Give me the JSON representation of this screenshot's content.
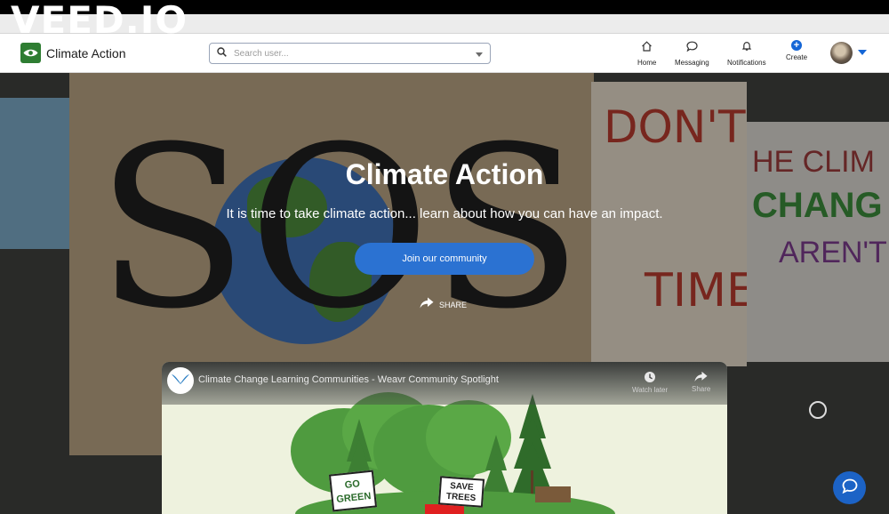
{
  "watermark": "VEED.IO",
  "brand": {
    "title": "Climate Action"
  },
  "search": {
    "placeholder": "Search user..."
  },
  "nav": [
    {
      "label": "Home",
      "icon": "home-icon"
    },
    {
      "label": "Messaging",
      "icon": "chat-bubble-icon"
    },
    {
      "label": "Notifications",
      "icon": "bell-icon"
    },
    {
      "label": "Create",
      "icon": "plus-circle-icon"
    }
  ],
  "hero": {
    "title": "Climate Action",
    "subtitle": "It is time to take climate action... learn about how you can have an impact.",
    "cta_label": "Join our community",
    "share_label": "SHARE",
    "signs": {
      "sos": "SOS",
      "dont": "DON'T",
      "time": "TIME",
      "clim": "HE CLIM",
      "chang": "CHANG",
      "arent": "AREN'T"
    }
  },
  "video": {
    "title": "Climate Change Learning Communities - Weavr Community Spotlight",
    "watch_later_label": "Watch later",
    "share_label": "Share",
    "art": {
      "go_green": "GO GREEN",
      "save_trees": "SAVE TREES"
    }
  },
  "colors": {
    "accent": "#2b72d2",
    "brand_green": "#2e7d32",
    "link_blue": "#1566d6"
  }
}
